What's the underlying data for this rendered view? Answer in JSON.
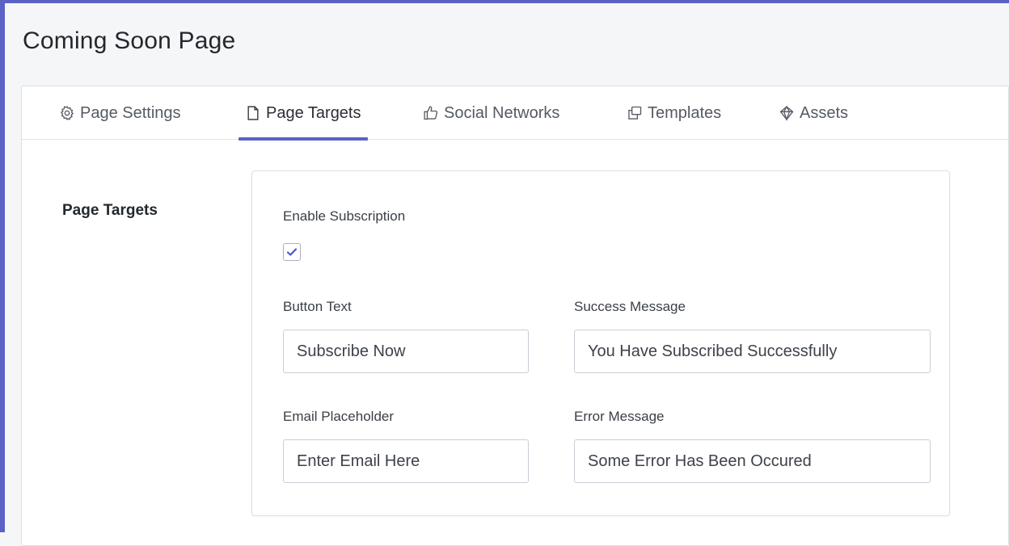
{
  "header": {
    "title": "Coming Soon Page"
  },
  "tabs": [
    {
      "label": "Page Settings",
      "icon": "gear-icon"
    },
    {
      "label": "Page Targets",
      "icon": "document-icon",
      "active": true
    },
    {
      "label": "Social Networks",
      "icon": "thumbs-up-icon"
    },
    {
      "label": "Templates",
      "icon": "copy-icon"
    },
    {
      "label": "Assets",
      "icon": "gem-icon"
    }
  ],
  "section": {
    "label": "Page Targets"
  },
  "form": {
    "enable_subscription": {
      "label": "Enable Subscription",
      "checked": true
    },
    "button_text": {
      "label": "Button Text",
      "value": "Subscribe Now"
    },
    "success_message": {
      "label": "Success Message",
      "value": "You Have Subscribed Successfully"
    },
    "email_placeholder": {
      "label": "Email Placeholder",
      "value": "Enter Email Here"
    },
    "error_message": {
      "label": "Error Message",
      "value": "Some Error Has Been Occured"
    }
  },
  "colors": {
    "accent": "#5b62c4",
    "border": "#dcdfe4",
    "background": "#f5f6f8"
  }
}
